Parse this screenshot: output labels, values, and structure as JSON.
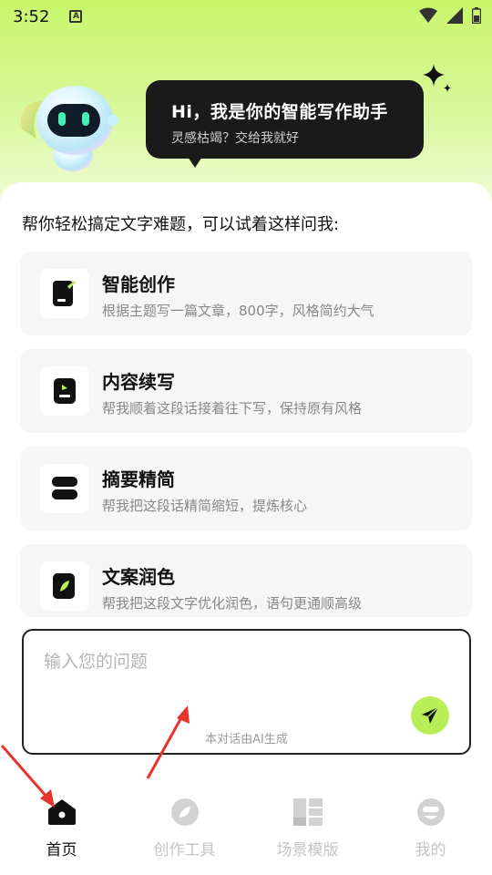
{
  "status_bar": {
    "time": "3:52",
    "notification_icon": "A"
  },
  "hero": {
    "bubble_title": "Hi，我是你的智能写作助手",
    "bubble_subtitle": "灵感枯竭？交给我就好"
  },
  "intro": "帮你轻松搞定文字难题，可以试着这样问我:",
  "cards": [
    {
      "title": "智能创作",
      "desc": "根据主题写一篇文章，800字，风格简约大气",
      "icon": "edit-document-icon"
    },
    {
      "title": "内容续写",
      "desc": "帮我顺着这段话接着往下写，保持原有风格",
      "icon": "continue-writing-icon"
    },
    {
      "title": "摘要精简",
      "desc": "帮我把这段话精简缩短，提炼核心",
      "icon": "summary-icon"
    },
    {
      "title": "文案润色",
      "desc": "帮我把这段文字优化润色，语句更通顺高级",
      "icon": "polish-icon"
    }
  ],
  "input": {
    "placeholder": "输入您的问题",
    "note": "本对话由AI生成"
  },
  "nav": [
    {
      "label": "首页",
      "icon": "home-icon",
      "active": true
    },
    {
      "label": "创作工具",
      "icon": "leaf-icon",
      "active": false
    },
    {
      "label": "场景模版",
      "icon": "template-icon",
      "active": false
    },
    {
      "label": "我的",
      "icon": "profile-icon",
      "active": false
    }
  ],
  "colors": {
    "accent": "#b8ee58",
    "header_green": "#c8f56a",
    "annotation_red": "#e8322c"
  }
}
